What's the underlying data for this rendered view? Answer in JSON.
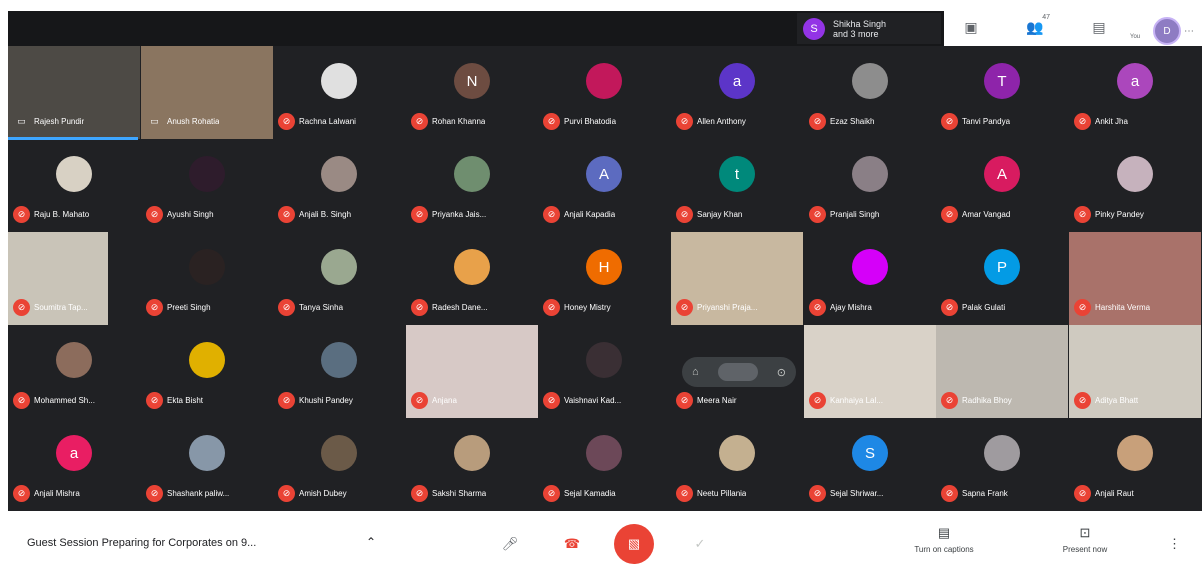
{
  "header": {
    "participants_chip": {
      "line1": "Shikha Singh",
      "line2": "and 3 more",
      "avatar_letter": "S",
      "avatar_color": "#9334e6"
    },
    "people_count": "47",
    "self_avatar_letter": "D",
    "self_label": "You"
  },
  "tiles": [
    {
      "row": 0,
      "col": 0,
      "name": "Rajesh Pundir",
      "type": "video",
      "bg": "#4d4a45"
    },
    {
      "row": 0,
      "col": 1,
      "name": "Anush Rohatia",
      "type": "video",
      "bg": "#8a7560"
    },
    {
      "row": 0,
      "col": 2,
      "name": "Rachna Lalwani",
      "type": "photo",
      "bg": "#e0e0e0"
    },
    {
      "row": 0,
      "col": 3,
      "name": "Rohan Khanna",
      "type": "letter",
      "letter": "N",
      "bg": "#6d4c41"
    },
    {
      "row": 0,
      "col": 4,
      "name": "Purvi Bhatodia",
      "type": "photo",
      "bg": "#c2185b"
    },
    {
      "row": 0,
      "col": 5,
      "name": "Allen Anthony",
      "type": "letter",
      "letter": "a",
      "bg": "#5c35c8"
    },
    {
      "row": 0,
      "col": 6,
      "name": "Ezaz Shaikh",
      "type": "photo",
      "bg": "#8d8d8d"
    },
    {
      "row": 0,
      "col": 7,
      "name": "Tanvi Pandya",
      "type": "letter",
      "letter": "T",
      "bg": "#8e24aa"
    },
    {
      "row": 0,
      "col": 8,
      "name": "Ankit Jha",
      "type": "letter",
      "letter": "a",
      "bg": "#ab47bc"
    },
    {
      "row": 1,
      "col": 0,
      "name": "Raju B. Mahato",
      "type": "photo",
      "bg": "#d8d1c4"
    },
    {
      "row": 1,
      "col": 1,
      "name": "Ayushi Singh",
      "type": "photo",
      "bg": "#2e1c2c"
    },
    {
      "row": 1,
      "col": 2,
      "name": "Anjali B. Singh",
      "type": "photo",
      "bg": "#9a8a84"
    },
    {
      "row": 1,
      "col": 3,
      "name": "Priyanka Jais...",
      "type": "photo",
      "bg": "#6f8e6f"
    },
    {
      "row": 1,
      "col": 4,
      "name": "Anjali Kapadia",
      "type": "letter",
      "letter": "A",
      "bg": "#5c6bc0"
    },
    {
      "row": 1,
      "col": 5,
      "name": "Sanjay Khan",
      "type": "letter",
      "letter": "t",
      "bg": "#00897b"
    },
    {
      "row": 1,
      "col": 6,
      "name": "Pranjali Singh",
      "type": "photo",
      "bg": "#8a7f86"
    },
    {
      "row": 1,
      "col": 7,
      "name": "Amar Vangad",
      "type": "letter",
      "letter": "A",
      "bg": "#d81b60"
    },
    {
      "row": 1,
      "col": 8,
      "name": "Pinky Pandey",
      "type": "photo",
      "bg": "#c6b2bd"
    },
    {
      "row": 2,
      "col": 0,
      "name": "Soumitra Tap...",
      "type": "video",
      "bg": "#c9c4b8"
    },
    {
      "row": 2,
      "col": 1,
      "name": "Preeti Singh",
      "type": "photo",
      "bg": "#2a2222"
    },
    {
      "row": 2,
      "col": 2,
      "name": "Tanya Sinha",
      "type": "photo",
      "bg": "#9aa890"
    },
    {
      "row": 2,
      "col": 3,
      "name": "Radesh Dane...",
      "type": "photo",
      "bg": "#e8a14a"
    },
    {
      "row": 2,
      "col": 4,
      "name": "Honey Mistry",
      "type": "letter",
      "letter": "H",
      "bg": "#ef6c00"
    },
    {
      "row": 2,
      "col": 5,
      "name": "Priyanshi Praja...",
      "type": "video",
      "bg": "#c8b8a0"
    },
    {
      "row": 2,
      "col": 6,
      "name": "Ajay Mishra",
      "type": "photo",
      "bg": "#d500f9"
    },
    {
      "row": 2,
      "col": 7,
      "name": "Palak Gulati",
      "type": "letter",
      "letter": "P",
      "bg": "#039be5"
    },
    {
      "row": 2,
      "col": 8,
      "name": "Harshita Verma",
      "type": "video",
      "bg": "#a9726a"
    },
    {
      "row": 3,
      "col": 0,
      "name": "Mohammed Sh...",
      "type": "photo",
      "bg": "#8c6c5c"
    },
    {
      "row": 3,
      "col": 1,
      "name": "Ekta Bisht",
      "type": "photo",
      "bg": "#e0b000"
    },
    {
      "row": 3,
      "col": 2,
      "name": "Khushi Pandey",
      "type": "photo",
      "bg": "#5a6e80"
    },
    {
      "row": 3,
      "col": 3,
      "name": "Anjana",
      "type": "video",
      "bg": "#d7c9c6"
    },
    {
      "row": 3,
      "col": 4,
      "name": "Vaishnavi Kad...",
      "type": "photo",
      "bg": "#3a2f34"
    },
    {
      "row": 3,
      "col": 5,
      "name": "Meera Nair",
      "type": "hidden",
      "bg": "#202124"
    },
    {
      "row": 3,
      "col": 6,
      "name": "Kanhaiya Lal...",
      "type": "video",
      "bg": "#d9d2c8"
    },
    {
      "row": 3,
      "col": 7,
      "name": "Radhika Bhoy",
      "type": "video",
      "bg": "#bdb8b0"
    },
    {
      "row": 3,
      "col": 8,
      "name": "Aditya Bhatt",
      "type": "video",
      "bg": "#cfcac0"
    },
    {
      "row": 4,
      "col": 0,
      "name": "Anjali Mishra",
      "type": "letter",
      "letter": "a",
      "bg": "#e91e63"
    },
    {
      "row": 4,
      "col": 1,
      "name": "Shashank paliw...",
      "type": "photo",
      "bg": "#8797a8"
    },
    {
      "row": 4,
      "col": 2,
      "name": "Amish Dubey",
      "type": "photo",
      "bg": "#6b5a48"
    },
    {
      "row": 4,
      "col": 3,
      "name": "Sakshi Sharma",
      "type": "photo",
      "bg": "#b89c7c"
    },
    {
      "row": 4,
      "col": 4,
      "name": "Sejal Kamadia",
      "type": "photo",
      "bg": "#6c4858"
    },
    {
      "row": 4,
      "col": 5,
      "name": "Neetu Pillania",
      "type": "photo",
      "bg": "#c4b090"
    },
    {
      "row": 4,
      "col": 6,
      "name": "Sejal Shriwar...",
      "type": "letter",
      "letter": "S",
      "bg": "#1e88e5"
    },
    {
      "row": 4,
      "col": 7,
      "name": "Sapna Frank",
      "type": "photo",
      "bg": "#9f9b9f"
    },
    {
      "row": 4,
      "col": 8,
      "name": "Anjali Raut",
      "type": "photo",
      "bg": "#c8a07a"
    }
  ],
  "floating_bar": {
    "left_icon": "pin-icon",
    "right_icon": "more-icon"
  },
  "bottom": {
    "meeting_title": "Guest Session Preparing for Corporates on 9...",
    "caret": "^",
    "controls": {
      "captions_label": "Turn on captions",
      "present_label": "Present now"
    }
  },
  "colors": {
    "grid_bg": "#202124",
    "mic_off": "#ea4335",
    "end_call": "#ea4335",
    "active_speaker": "#3ea6ff"
  }
}
